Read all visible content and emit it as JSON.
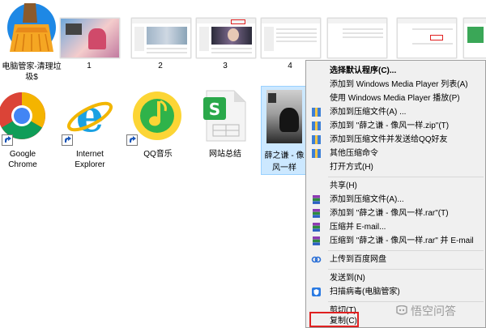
{
  "desktop": {
    "top_row": [
      {
        "label": "电脑管家-清理垃圾$"
      },
      {
        "label": "1"
      },
      {
        "label": "2"
      },
      {
        "label": "3"
      },
      {
        "label": "4"
      }
    ],
    "bottom_row": [
      {
        "label": "Google Chrome"
      },
      {
        "label": "Internet Explorer"
      },
      {
        "label": "QQ音乐"
      },
      {
        "label": "网站总结"
      },
      {
        "label": "薛之谦 - 像风一样"
      }
    ]
  },
  "context_menu": {
    "items": [
      {
        "label": "选择默认程序(C)...",
        "icon": "none",
        "bold": true
      },
      {
        "label": "添加到 Windows Media Player 列表(A)",
        "icon": "none"
      },
      {
        "label": "使用 Windows Media Player 播放(P)",
        "icon": "none"
      },
      {
        "label": "添加到压缩文件(A) ...",
        "icon": "zip-icon"
      },
      {
        "label": "添加到 \"薛之谦 - 像风一样.zip\"(T)",
        "icon": "zip-icon"
      },
      {
        "label": "添加到压缩文件并发送给QQ好友",
        "icon": "zip-icon"
      },
      {
        "label": "其他压缩命令",
        "icon": "zip-icon"
      },
      {
        "label": "打开方式(H)",
        "icon": "none"
      },
      {
        "label": "共享(H)",
        "icon": "none"
      },
      {
        "label": "添加到压缩文件(A)...",
        "icon": "winrar-icon"
      },
      {
        "label": "添加到 \"薛之谦 - 像风一样.rar\"(T)",
        "icon": "winrar-icon"
      },
      {
        "label": "压缩并 E-mail...",
        "icon": "winrar-icon"
      },
      {
        "label": "压缩到 \"薛之谦 - 像风一样.rar\" 并 E-mail",
        "icon": "winrar-icon"
      },
      {
        "label": "上传到百度网盘",
        "icon": "baidu-cloud-icon"
      },
      {
        "label": "发送到(N)",
        "icon": "none"
      },
      {
        "label": "扫描病毒(电脑管家)",
        "icon": "shield-icon"
      },
      {
        "label": "剪切(T)",
        "icon": "none"
      },
      {
        "label": "复制(C)",
        "icon": "none"
      }
    ]
  },
  "watermark": {
    "text": "悟空问答"
  },
  "colors": {
    "selection": "#cce8ff",
    "highlight_border": "#e02020",
    "menu_bg": "#f0f0f0"
  }
}
